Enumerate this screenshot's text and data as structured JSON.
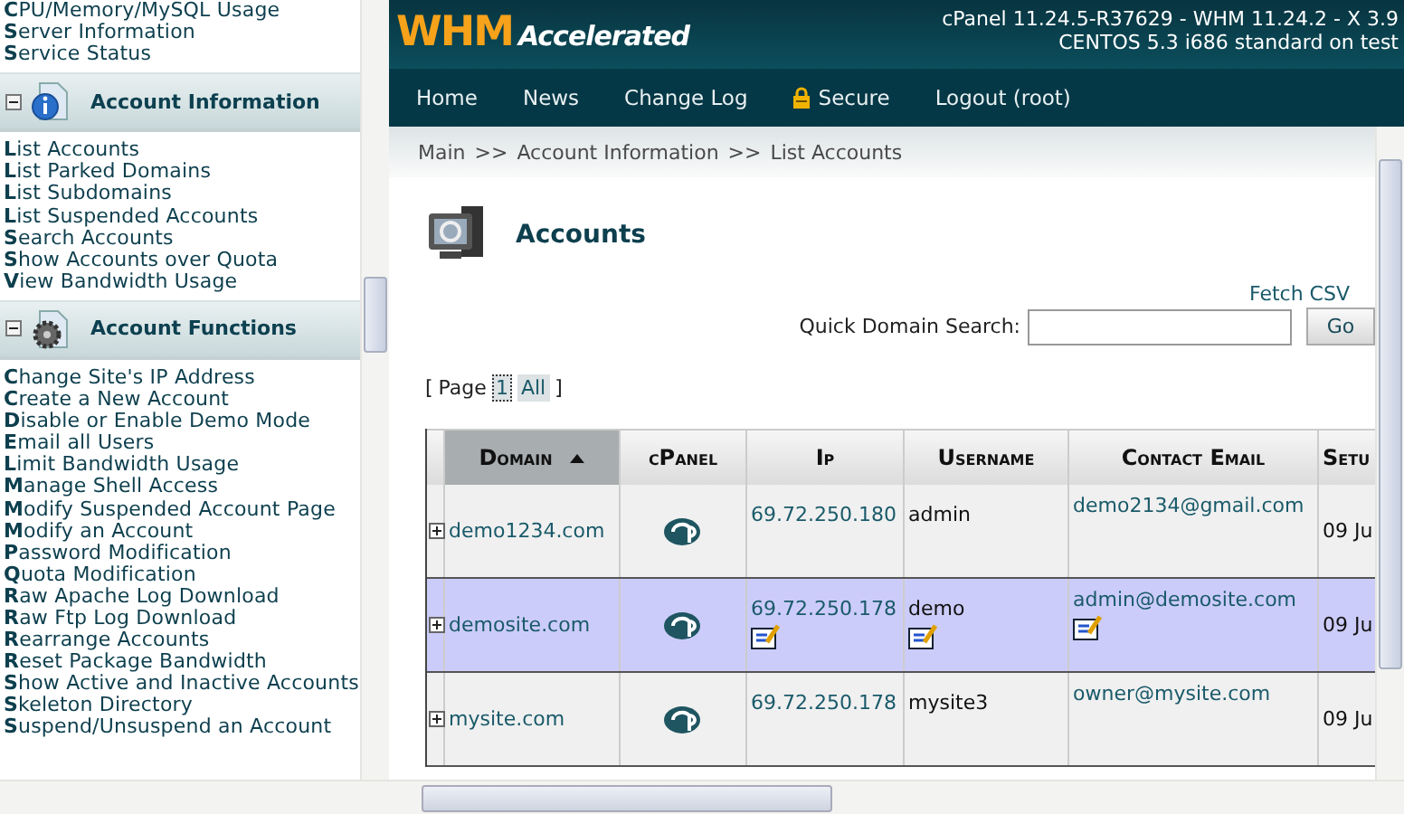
{
  "sidebar": {
    "top_items": [
      "CPU/Memory/MySQL Usage",
      "Server Information",
      "Service Status"
    ],
    "sections": [
      {
        "title": "Account Information",
        "expanded": true,
        "items": [
          "List Accounts",
          "List Parked Domains",
          "List Subdomains",
          "List Suspended Accounts",
          "Search Accounts",
          "Show Accounts over Quota",
          "View Bandwidth Usage"
        ]
      },
      {
        "title": "Account Functions",
        "expanded": true,
        "items": [
          "Change Site's IP Address",
          "Create a New Account",
          "Disable or Enable Demo Mode",
          "Email all Users",
          "Limit Bandwidth Usage",
          "Manage Shell Access",
          "Modify Suspended Account Page",
          "Modify an Account",
          "Password Modification",
          "Quota Modification",
          "Raw Apache Log Download",
          "Raw Ftp Log Download",
          "Rearrange Accounts",
          "Reset Package Bandwidth",
          "Show Active and Inactive Accounts",
          "Skeleton Directory",
          "Suspend/Unsuspend an Account"
        ]
      }
    ]
  },
  "header": {
    "logo": {
      "brand": "WHM",
      "product": "Accelerated"
    },
    "version_lines": [
      "cPanel 11.24.5-R37629 - WHM 11.24.2 - X 3.9",
      "CENTOS 5.3 i686 standard on test"
    ]
  },
  "nav": [
    {
      "label": "Home",
      "kind": "link"
    },
    {
      "label": "News",
      "kind": "link"
    },
    {
      "label": "Change Log",
      "kind": "link"
    },
    {
      "label": "Secure",
      "kind": "secure"
    },
    {
      "label": "Logout (root)",
      "kind": "link"
    }
  ],
  "breadcrumb": {
    "separator": ">>",
    "items": [
      "Main",
      "Account Information",
      "List Accounts"
    ]
  },
  "page": {
    "title": "Accounts",
    "fetch_csv": "Fetch CSV",
    "search": {
      "label": "Quick Domain Search:",
      "button": "Go"
    },
    "pagination": {
      "open": "[",
      "label": "Page",
      "close": "]",
      "pages": [
        {
          "label": "1",
          "selected": true
        },
        {
          "label": "All",
          "selected": false
        }
      ]
    }
  },
  "table": {
    "columns": [
      {
        "label": "Domain",
        "sorted": true
      },
      {
        "label": "cPanel",
        "sorted": false
      },
      {
        "label": "Ip",
        "sorted": false
      },
      {
        "label": "Username",
        "sorted": false
      },
      {
        "label": "Contact Email",
        "sorted": false
      },
      {
        "label": "Setu",
        "sorted": false
      }
    ],
    "rows": [
      {
        "domain": "demo1234.com",
        "ip": "69.72.250.180",
        "username": "admin",
        "email": "demo2134@gmail.com",
        "setup": "09 Ju",
        "hovered": false
      },
      {
        "domain": "demosite.com",
        "ip": "69.72.250.178",
        "username": "demo",
        "email": "admin@demosite.com",
        "setup": "09 Ju",
        "hovered": true
      },
      {
        "domain": "mysite.com",
        "ip": "69.72.250.178",
        "username": "mysite3",
        "email": "owner@mysite.com",
        "setup": "09 Ju",
        "hovered": false
      }
    ]
  }
}
